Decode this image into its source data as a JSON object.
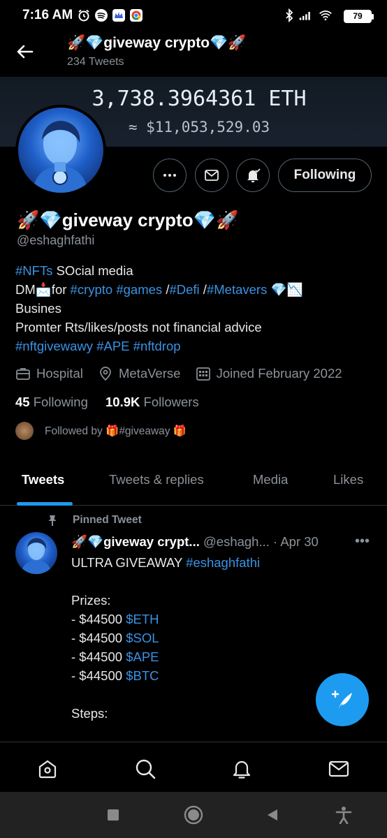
{
  "status_bar": {
    "time": "7:16 AM",
    "battery": "79"
  },
  "header": {
    "title": "🚀💎giveway crypto💎🚀",
    "tweet_count": "234 Tweets"
  },
  "banner": {
    "eth": "3,738.3964361 ETH",
    "usd": "≈ $11,053,529.03"
  },
  "actions": {
    "following_label": "Following"
  },
  "profile": {
    "name": "🚀💎giveway crypto💎🚀",
    "handle": "@eshaghfathi",
    "bio": {
      "line1_tag": "#NFTs",
      "line1_text": " SOcial media",
      "line2_dm": "DM📩for ",
      "line2_tag1": "#crypto",
      "line2_tag2": "#games",
      "line2_sep1": " /",
      "line2_tag3": "#Defi",
      "line2_sep2": " /",
      "line2_tag4": "#Metavers",
      "line2_end": " 💎📉",
      "line3": "Busines",
      "line4": "Promter Rts/likes/posts not financial advice",
      "line5_tag1": "#nftgivewawy",
      "line5_tag2": "#APE",
      "line5_tag3": "#nftdrop"
    },
    "category": "Hospital",
    "location": "MetaVerse",
    "joined": "Joined February 2022",
    "following_count": "45",
    "following_label": "Following",
    "followers_count": "10.9K",
    "followers_label": "Followers",
    "followed_by": "Followed by 🎁#giveaway 🎁"
  },
  "tabs": [
    "Tweets",
    "Tweets & replies",
    "Media",
    "Likes"
  ],
  "tweet": {
    "pinned_label": "Pinned Tweet",
    "name": "🚀💎giveway crypt...",
    "handle": "@eshagh...",
    "date": "· Apr 30",
    "line1": "ULTRA GIVEAWAY ",
    "line1_tag": "#eshaghfathi",
    "prizes_label": "Prizes:",
    "prize_prefix": "- $44500 ",
    "prizes": [
      "$ETH",
      "$SOL",
      "$APE",
      "$BTC"
    ],
    "steps_label": "Steps:"
  },
  "colors": {
    "accent": "#1d9bf0",
    "link": "#3b92e3",
    "muted": "#8b9299",
    "background": "#000000"
  }
}
